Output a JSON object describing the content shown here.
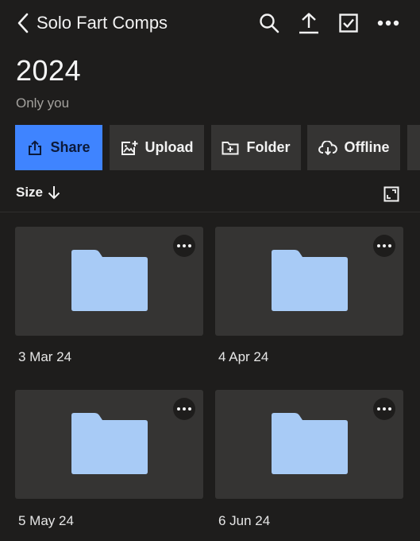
{
  "nav": {
    "title": "Solo Fart Comps",
    "icons": [
      "back-chevron-icon",
      "search-icon",
      "upload-icon",
      "select-checkbox-icon",
      "more-horizontal-icon"
    ]
  },
  "folder": {
    "name": "2024",
    "sharing": "Only you"
  },
  "actions": {
    "share": "Share",
    "upload": "Upload",
    "folder": "Folder",
    "offline": "Offline"
  },
  "sort": {
    "label": "Size",
    "direction_icon": "arrow-down-icon"
  },
  "colors": {
    "background": "#1e1d1c",
    "card": "#353433",
    "primary": "#3f84ff",
    "folder": "#a8cbf6"
  },
  "items": [
    {
      "name": "3 Mar 24",
      "type": "folder"
    },
    {
      "name": "4 Apr 24",
      "type": "folder"
    },
    {
      "name": "5 May 24",
      "type": "folder"
    },
    {
      "name": "6 Jun 24",
      "type": "folder"
    }
  ]
}
